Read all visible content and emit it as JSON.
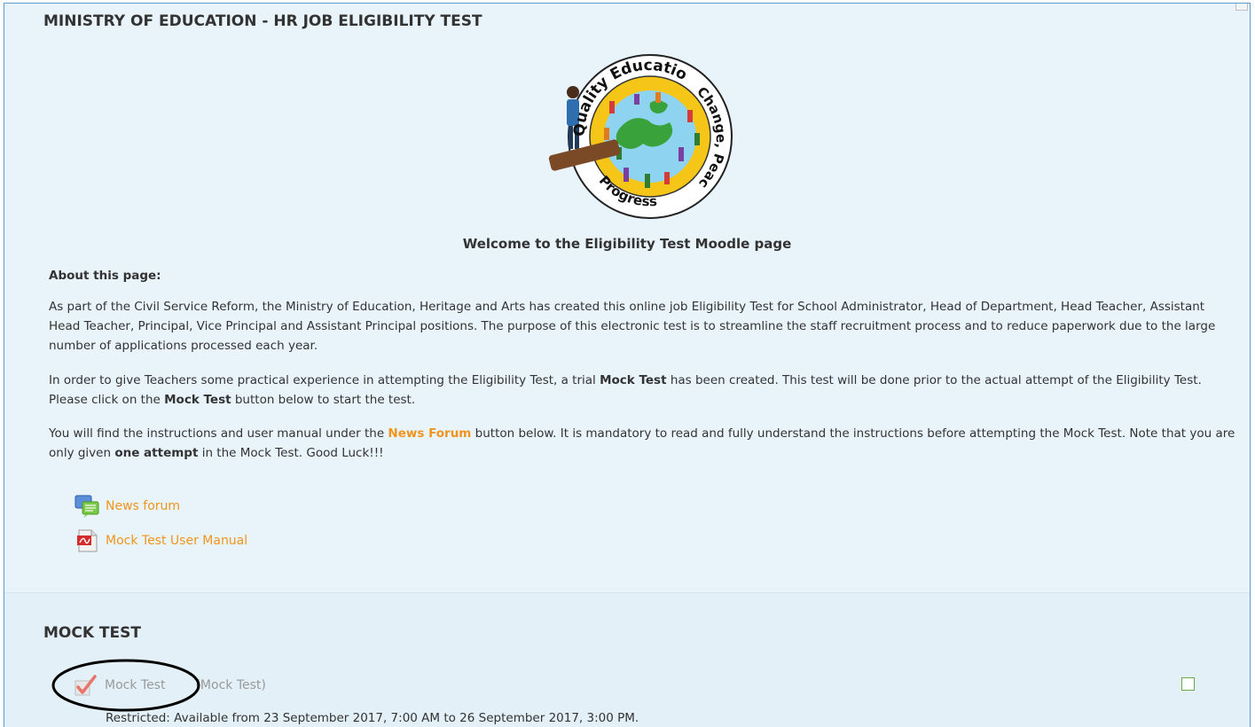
{
  "header": {
    "title": "MINISTRY OF EDUCATION - HR JOB ELIGIBILITY TEST"
  },
  "logo": {
    "arc_top": "Quality Education for",
    "arc_right": "Change, Peace and",
    "arc_bottom": "Progress"
  },
  "welcome": "Welcome to the Eligibility Test Moodle page",
  "about": {
    "title": "About this page:",
    "p1": "As part of the Civil Service Reform, the Ministry of Education, Heritage and Arts has created this online job Eligibility Test for School Administrator, Head of Department, Head Teacher, Assistant Head Teacher, Principal, Vice Principal and Assistant Principal positions. The purpose of this electronic test is to streamline the staff recruitment process and to reduce paperwork due to the large number of applications processed each year.",
    "p2_a": "In order to give Teachers some practical experience in attempting the Eligibility Test, a trial ",
    "p2_b": "Mock Test",
    "p2_c": " has been created. This test will be done prior to the actual attempt of the Eligibility Test. Please click on the ",
    "p2_d": "Mock Test",
    "p2_e": " button below to start the test.",
    "p3_a": "You will find the instructions and user manual under the ",
    "p3_b": "News Forum",
    "p3_c": " button below. It is mandatory to read and fully understand the instructions before attempting the Mock Test. Note that you are only given ",
    "p3_d": "one attempt",
    "p3_e": " in the Mock Test. Good Luck!!!"
  },
  "links": {
    "news_forum": "News forum",
    "user_manual": "Mock Test User Manual"
  },
  "mock_section": {
    "title": "MOCK TEST",
    "activity_name": "Mock Test",
    "activity_type": "(Mock Test)",
    "restriction": "Restricted: Available from 23 September 2017, 7:00 AM to 26 September 2017, 3:00 PM."
  },
  "colors": {
    "link_orange": "#f0941e",
    "page_bg": "#e8f4fa",
    "completion_green": "#6aa84f"
  }
}
